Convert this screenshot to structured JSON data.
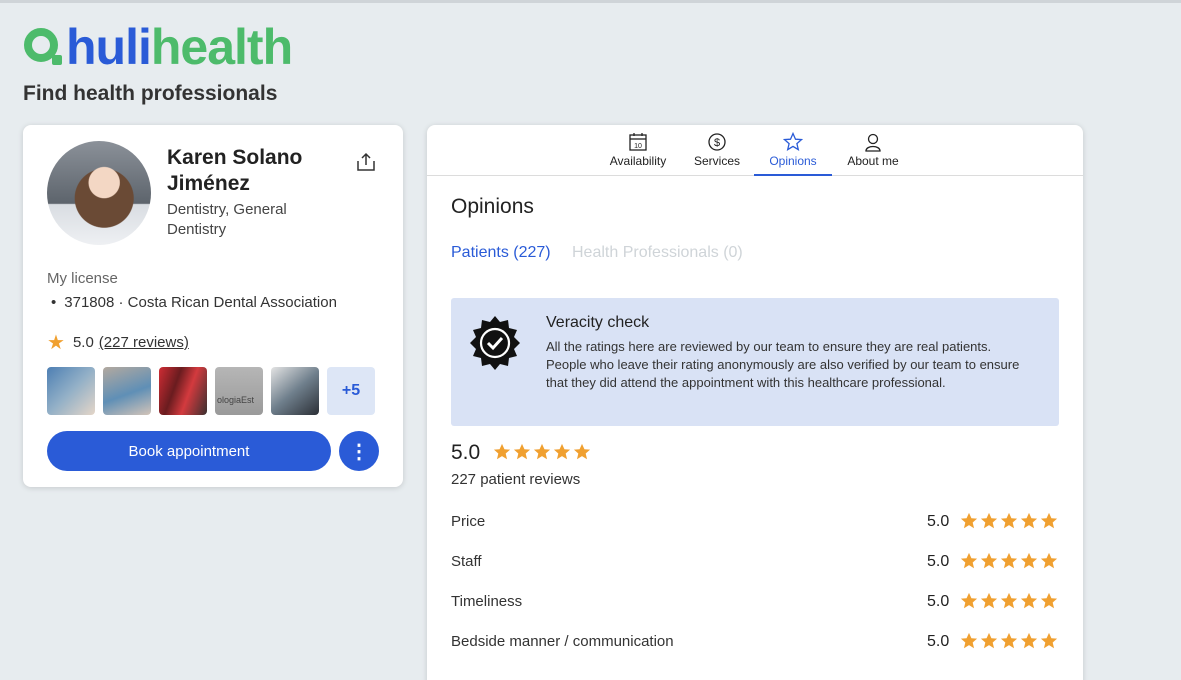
{
  "header": {
    "logo_part1": "huli",
    "logo_part2": "health",
    "tagline": "Find health professionals"
  },
  "profile": {
    "name": "Karen Solano Jiménez",
    "specialty": "Dentistry, General Dentistry",
    "license_title": "My license",
    "license_item": "371808 · Costa Rican Dental Association",
    "rating": "5.0",
    "reviews_link": "(227 reviews)",
    "thumb_caption": "ologiaEst",
    "more_photos": "+5",
    "book_button": "Book appointment",
    "more_button": "⋮"
  },
  "tabs": [
    {
      "label": "Availability",
      "icon": "calendar-icon",
      "calendar_day": "10"
    },
    {
      "label": "Services",
      "icon": "dollar-icon"
    },
    {
      "label": "Opinions",
      "icon": "star-outline-icon",
      "active": true
    },
    {
      "label": "About me",
      "icon": "person-icon"
    }
  ],
  "opinions": {
    "title": "Opinions",
    "subtabs": [
      "Patients (227)",
      "Health Professionals (0)"
    ],
    "veracity": {
      "title": "Veracity check",
      "text": "All the ratings here are reviewed by our team to ensure they are real patients. People who leave their rating anonymously are also verified by our team to ensure that they did attend the appointment with this healthcare professional."
    },
    "overall_score": "5.0",
    "overall_stars": 5,
    "review_count": "227 patient reviews",
    "criteria": [
      {
        "label": "Price",
        "score": "5.0",
        "stars": 5
      },
      {
        "label": "Staff",
        "score": "5.0",
        "stars": 5
      },
      {
        "label": "Timeliness",
        "score": "5.0",
        "stars": 5
      },
      {
        "label": "Bedside manner / communication",
        "score": "5.0",
        "stars": 5
      }
    ]
  },
  "colors": {
    "brand_blue": "#2a5bd7",
    "brand_green": "#4dbb6b",
    "star": "#f0a030",
    "background": "#e7ecef"
  }
}
